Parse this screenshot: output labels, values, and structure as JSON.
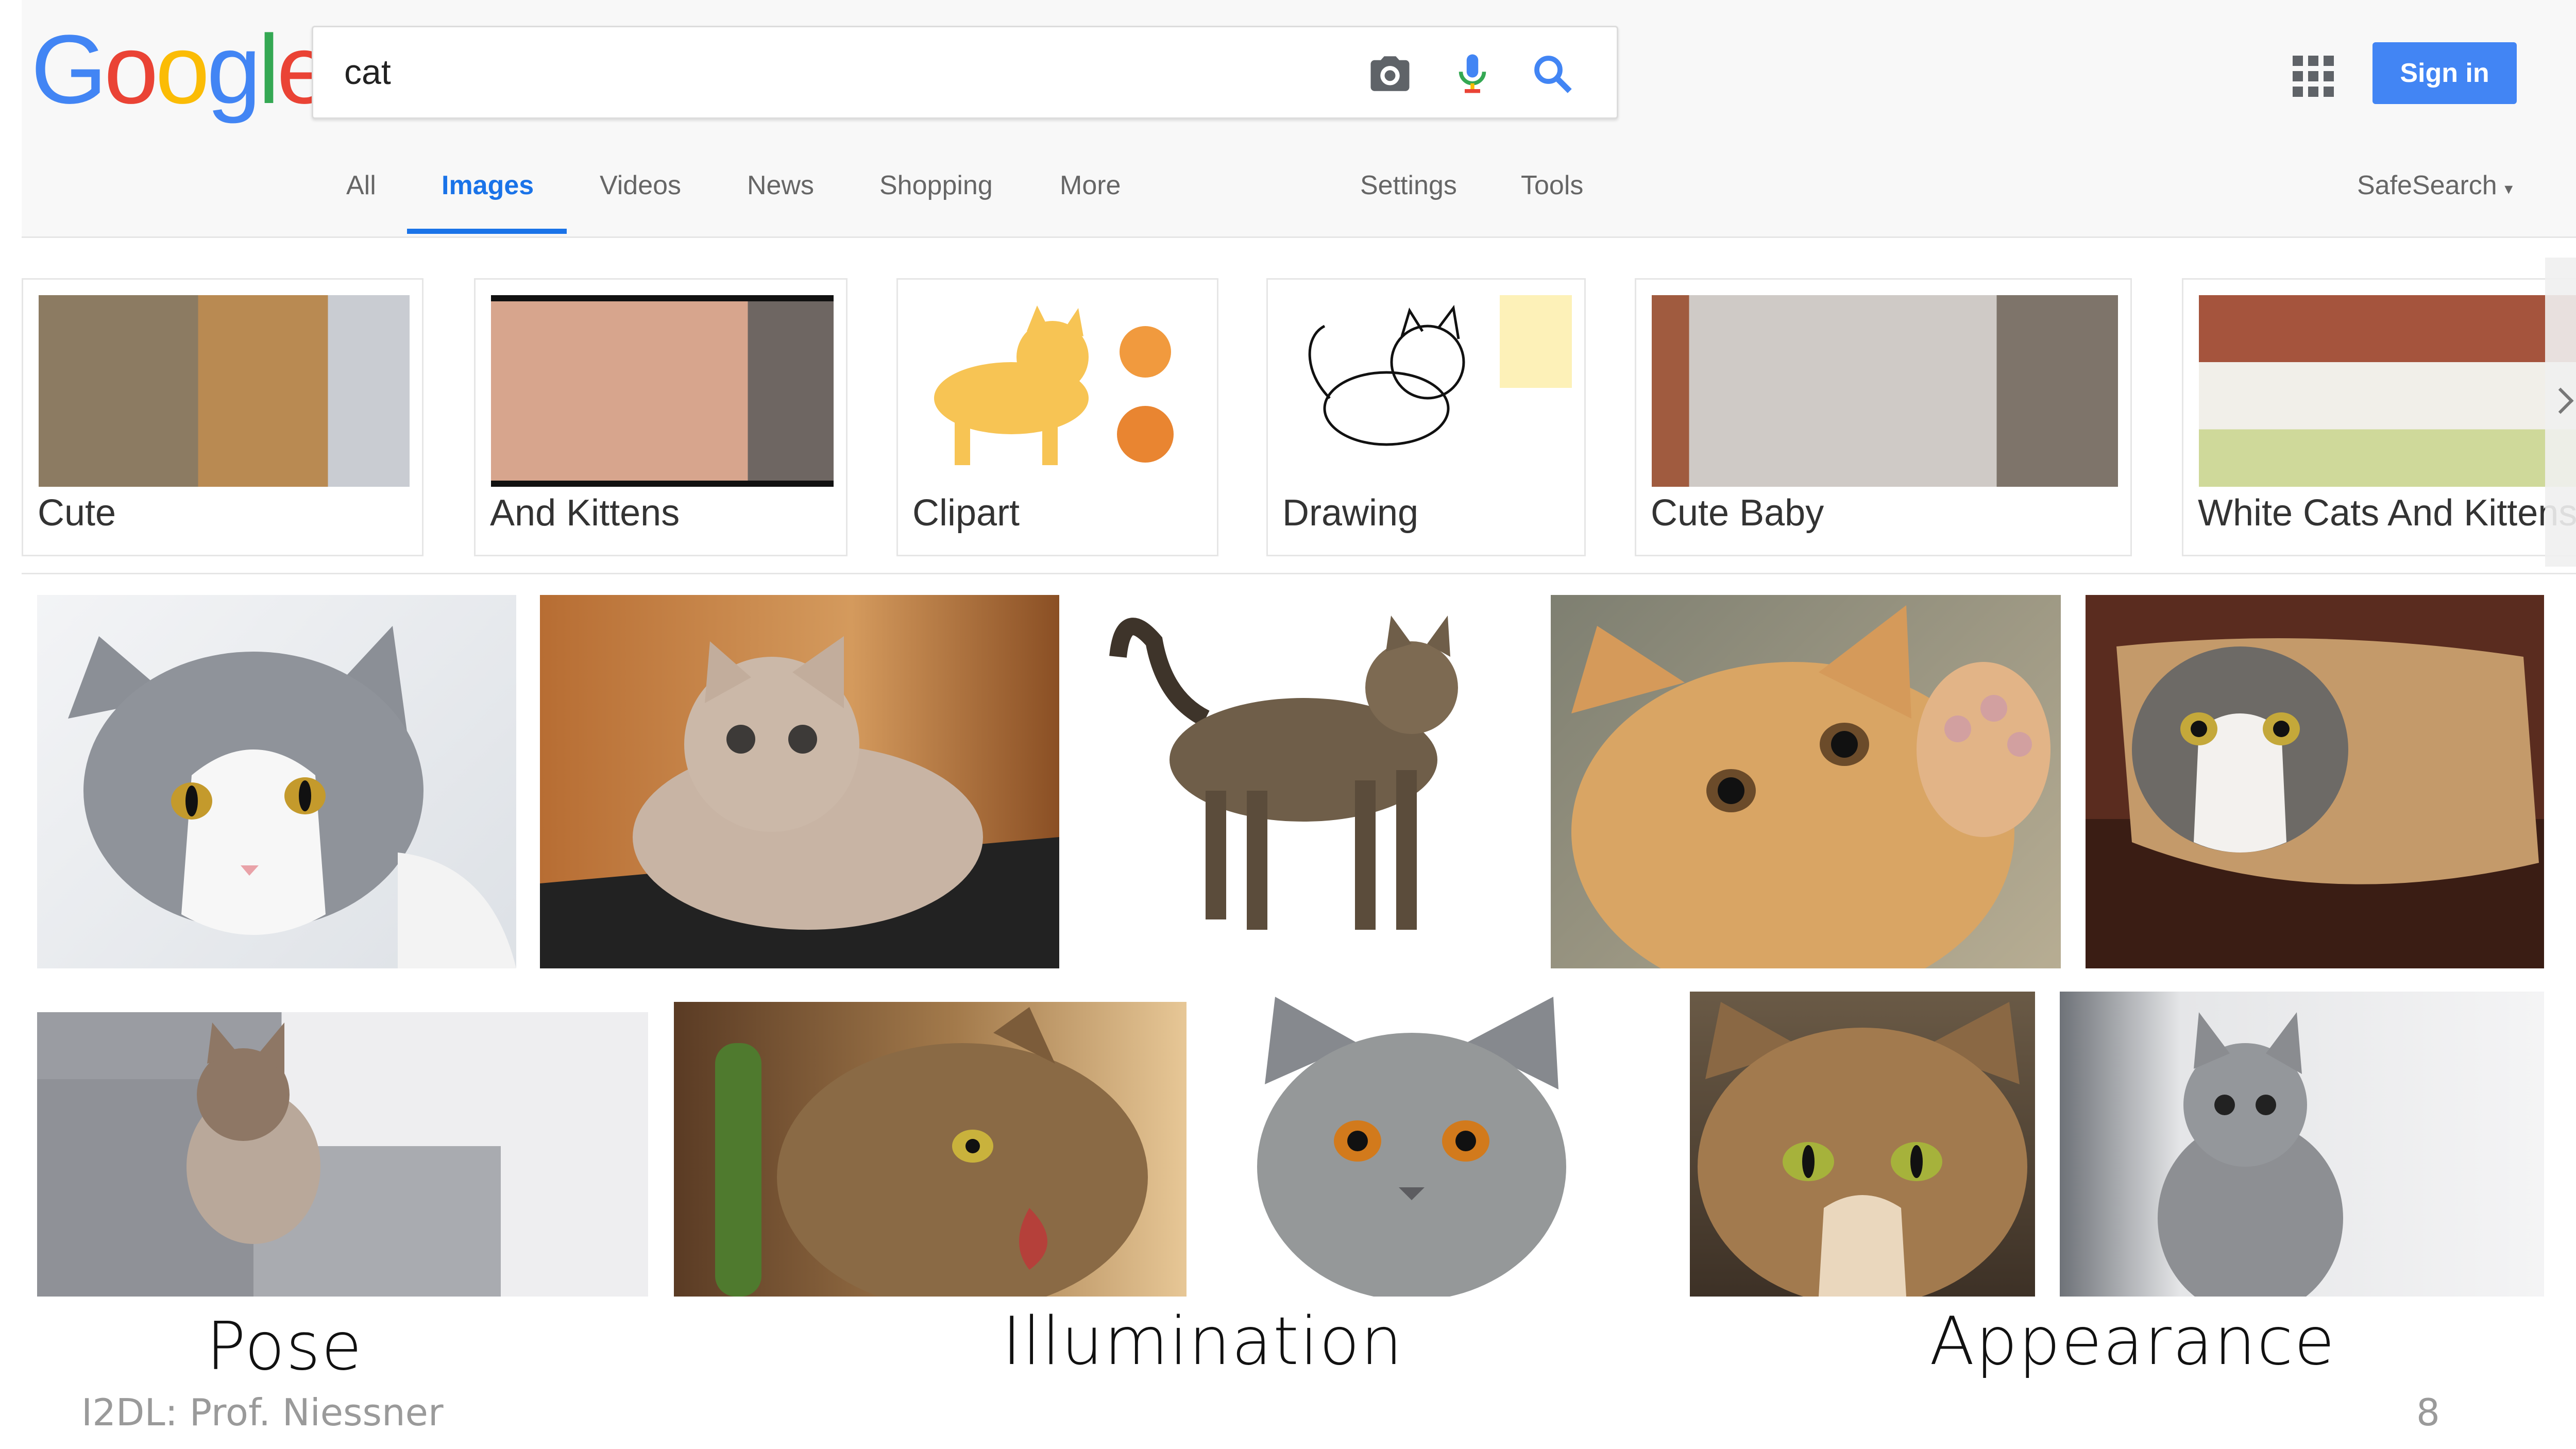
{
  "logo": {
    "letters": [
      "G",
      "o",
      "o",
      "g",
      "l",
      "e"
    ],
    "colors": [
      "#4285f4",
      "#ea4335",
      "#fbbc05",
      "#4285f4",
      "#34a853",
      "#ea4335"
    ]
  },
  "search": {
    "query": "cat"
  },
  "icons": {
    "camera": "camera-icon",
    "mic": "microphone-icon",
    "search": "search-icon",
    "apps": "apps-grid-icon"
  },
  "header": {
    "sign_in": "Sign in",
    "safesearch": "SafeSearch"
  },
  "tabs": [
    {
      "label": "All"
    },
    {
      "label": "Images",
      "active": true
    },
    {
      "label": "Videos"
    },
    {
      "label": "News"
    },
    {
      "label": "Shopping"
    },
    {
      "label": "More"
    },
    {
      "label": "Settings"
    },
    {
      "label": "Tools"
    }
  ],
  "chips": [
    {
      "label": "Cute"
    },
    {
      "label": "And Kittens"
    },
    {
      "label": "Clipart"
    },
    {
      "label": "Drawing"
    },
    {
      "label": "Cute Baby"
    },
    {
      "label": "White Cats And Kittens"
    }
  ],
  "captions": {
    "pose": "Pose",
    "illumination": "Illumination",
    "appearance": "Appearance"
  },
  "footer": {
    "credit": "I2DL: Prof. Niessner",
    "page": "8"
  },
  "colors": {
    "accent": "#1a73e8",
    "signin": "#4285f4"
  }
}
